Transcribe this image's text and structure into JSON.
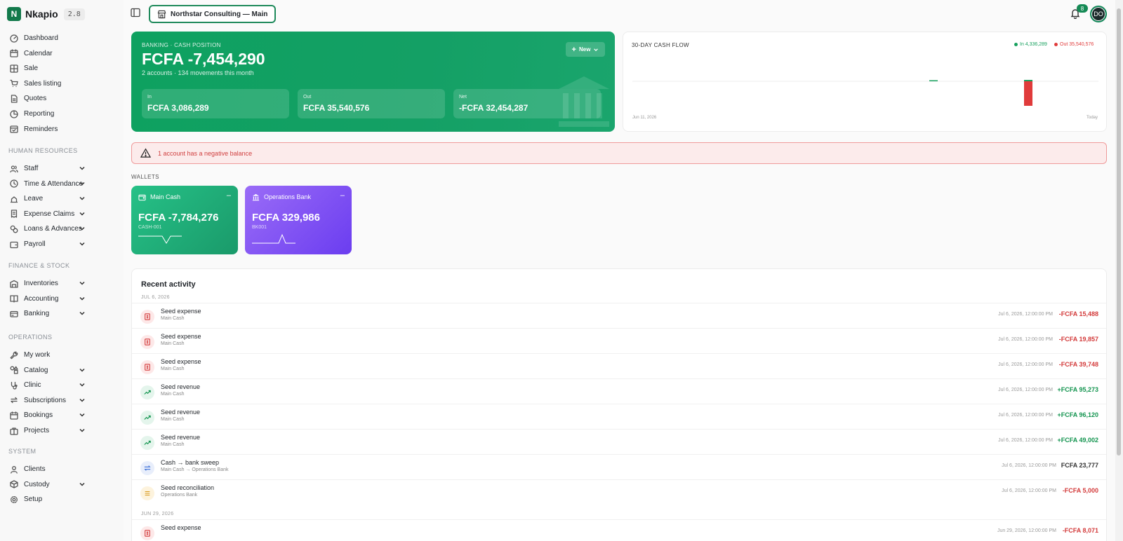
{
  "app": {
    "name": "Nkapio",
    "version": "2.8",
    "company": "Northstar Consulting — Main",
    "notification_count": "8",
    "avatar_initials": "DO"
  },
  "sidebar": {
    "top_items": [
      {
        "label": "Dashboard",
        "icon": "dashboard-icon"
      },
      {
        "label": "Calendar",
        "icon": "calendar-icon"
      },
      {
        "label": "Sale",
        "icon": "grid-icon"
      },
      {
        "label": "Sales listing",
        "icon": "cart-icon"
      },
      {
        "label": "Quotes",
        "icon": "document-icon"
      },
      {
        "label": "Reporting",
        "icon": "chart-icon"
      },
      {
        "label": "Reminders",
        "icon": "calendar-check-icon"
      }
    ],
    "sections": [
      {
        "label": "HUMAN RESOURCES",
        "items": [
          {
            "label": "Staff",
            "icon": "users-icon",
            "expandable": true
          },
          {
            "label": "Time & Attendance",
            "icon": "clock-icon",
            "expandable": true
          },
          {
            "label": "Leave",
            "icon": "leave-icon",
            "expandable": true
          },
          {
            "label": "Expense Claims",
            "icon": "receipt-icon",
            "expandable": true
          },
          {
            "label": "Loans & Advances",
            "icon": "coins-icon",
            "expandable": true
          },
          {
            "label": "Payroll",
            "icon": "wallet-icon",
            "expandable": true
          }
        ]
      },
      {
        "label": "FINANCE & STOCK",
        "items": [
          {
            "label": "Inventories",
            "icon": "warehouse-icon",
            "expandable": true
          },
          {
            "label": "Accounting",
            "icon": "book-icon",
            "expandable": true
          },
          {
            "label": "Banking",
            "icon": "bank-card-icon",
            "expandable": true
          }
        ]
      },
      {
        "label": "OPERATIONS",
        "items": [
          {
            "label": "My work",
            "icon": "wrench-icon",
            "expandable": false
          },
          {
            "label": "Catalog",
            "icon": "shapes-icon",
            "expandable": true
          },
          {
            "label": "Clinic",
            "icon": "stethoscope-icon",
            "expandable": true
          },
          {
            "label": "Subscriptions",
            "icon": "repeat-icon",
            "expandable": true
          },
          {
            "label": "Bookings",
            "icon": "calendar-icon",
            "expandable": true
          },
          {
            "label": "Projects",
            "icon": "briefcase-icon",
            "expandable": true
          }
        ]
      },
      {
        "label": "SYSTEM",
        "items": [
          {
            "label": "Clients",
            "icon": "user-icon",
            "expandable": false
          },
          {
            "label": "Custody",
            "icon": "box-icon",
            "expandable": true
          },
          {
            "label": "Setup",
            "icon": "gear-icon",
            "expandable": false
          }
        ]
      }
    ]
  },
  "hero": {
    "kicker": "BANKING · CASH POSITION",
    "balance": "FCFA -7,454,290",
    "subtitle": "2 accounts · 134 movements this month",
    "new_label": "New",
    "tiles": [
      {
        "label": "In",
        "value": "FCFA 3,086,289"
      },
      {
        "label": "Out",
        "value": "FCFA 35,540,576"
      },
      {
        "label": "Net",
        "value": "-FCFA 32,454,287"
      }
    ]
  },
  "cashflow": {
    "title": "30-DAY CASH FLOW",
    "legend_in": "In 4,336,289",
    "legend_out": "Out 35,540,576",
    "x_start": "Jun 11, 2026",
    "x_end": "Today",
    "colors": {
      "in": "#16a05d",
      "out": "#e03b3b"
    }
  },
  "chart_data": {
    "type": "bar",
    "title": "30-DAY CASH FLOW",
    "x": [
      "Jun 11, 2026",
      "Today"
    ],
    "series": [
      {
        "name": "In",
        "values": [
          4336289
        ]
      },
      {
        "name": "Out",
        "values": [
          35540576
        ]
      }
    ]
  },
  "alert": {
    "text": "1 account has a negative balance"
  },
  "wallets": {
    "label": "WALLETS",
    "items": [
      {
        "name": "Main Cash",
        "amount": "FCFA -7,784,276",
        "code": "CASH-001"
      },
      {
        "name": "Operations Bank",
        "amount": "FCFA 329,986",
        "code": "BK001"
      }
    ]
  },
  "activity": {
    "title": "Recent activity",
    "groups": [
      {
        "date": "JUL 6, 2026",
        "rows": [
          {
            "title": "Seed expense",
            "sub": "Main Cash",
            "time": "Jul 6, 2026, 12:00:00 PM",
            "amount": "-FCFA 15,488",
            "kind": "expense"
          },
          {
            "title": "Seed expense",
            "sub": "Main Cash",
            "time": "Jul 6, 2026, 12:00:00 PM",
            "amount": "-FCFA 19,857",
            "kind": "expense"
          },
          {
            "title": "Seed expense",
            "sub": "Main Cash",
            "time": "Jul 6, 2026, 12:00:00 PM",
            "amount": "-FCFA 39,748",
            "kind": "expense"
          },
          {
            "title": "Seed revenue",
            "sub": "Main Cash",
            "time": "Jul 6, 2026, 12:00:00 PM",
            "amount": "+FCFA 95,273",
            "kind": "revenue"
          },
          {
            "title": "Seed revenue",
            "sub": "Main Cash",
            "time": "Jul 6, 2026, 12:00:00 PM",
            "amount": "+FCFA 96,120",
            "kind": "revenue"
          },
          {
            "title": "Seed revenue",
            "sub": "Main Cash",
            "time": "Jul 6, 2026, 12:00:00 PM",
            "amount": "+FCFA 49,002",
            "kind": "revenue"
          },
          {
            "title": "Cash → bank sweep",
            "sub": "Main Cash → Operations Bank",
            "time": "Jul 6, 2026, 12:00:00 PM",
            "amount": "FCFA 23,777",
            "kind": "transfer"
          },
          {
            "title": "Seed reconciliation",
            "sub": "Operations Bank",
            "time": "Jul 6, 2026, 12:00:00 PM",
            "amount": "-FCFA 5,000",
            "kind": "reconciliation"
          }
        ]
      },
      {
        "date": "JUN 29, 2026",
        "rows": [
          {
            "title": "Seed expense",
            "sub": "",
            "time": "Jun 29, 2026, 12:00:00 PM",
            "amount": "-FCFA 8,071",
            "kind": "expense"
          }
        ]
      }
    ]
  }
}
